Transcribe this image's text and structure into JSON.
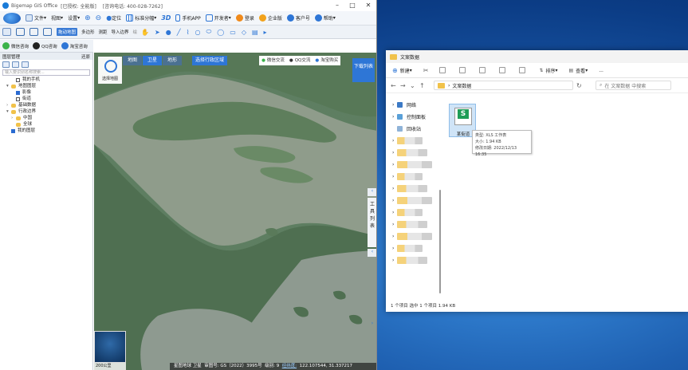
{
  "gis": {
    "title": "Bigemap GIS Office",
    "auth": "[已授权: 全能版]",
    "hotline": "[咨询电话: 400-028-7262]",
    "menu": {
      "file": "文件",
      "view": "视图",
      "settings": "设置",
      "locate": "定位",
      "tiles": "标准分幅",
      "three_d": "3D",
      "mobile": "手机APP",
      "dev": "开发者",
      "login": "登录",
      "enterprise": "企业版",
      "customer": "客户号",
      "help": "帮助"
    },
    "toolbar": {
      "drag": "拖动地图",
      "polygon": "多边形",
      "measure": "测距",
      "import": "导入边界",
      "draw_label": "绘"
    },
    "toolbar2": {
      "wechat": "微信咨询",
      "qq": "QQ咨询",
      "taobao": "淘宝咨询"
    },
    "layers_panel": {
      "title": "图层管理",
      "restore": "还原",
      "search_placeholder": "输入要识别名称搜索...",
      "items": [
        {
          "label": "我的手机",
          "check": false,
          "caret": ""
        },
        {
          "label": "地图图层",
          "check": null,
          "caret": "▾"
        },
        {
          "label": "影像",
          "check": true,
          "caret": ""
        },
        {
          "label": "街道",
          "check": false,
          "caret": ""
        },
        {
          "label": "基础数据",
          "check": null,
          "caret": "›"
        },
        {
          "label": "行政边界",
          "check": null,
          "caret": "▾"
        },
        {
          "label": "中国",
          "check": null,
          "caret": "›"
        },
        {
          "label": "全球",
          "check": null,
          "caret": ""
        },
        {
          "label": "我的图层",
          "check": true,
          "caret": ""
        }
      ]
    },
    "map": {
      "logo_text": "选择地图",
      "tabs": [
        "地图",
        "卫星",
        "地形"
      ],
      "selected_tab": "卫星",
      "region_btn": "选择行政区域",
      "wechat": "微信交流",
      "qq": "QQ交流",
      "taobao": "淘宝购买",
      "download_list": "下载列表",
      "tools_list": [
        "工",
        "具",
        "列",
        "表"
      ],
      "scale": "200公里",
      "status": {
        "source": "星图地球 卫星",
        "approval": "审图号: GS（2022）3995号",
        "level": "级别: 9",
        "coords_label": "经纬度:",
        "coords": "122.107544, 31.337217"
      }
    }
  },
  "explorer": {
    "title": "文案数据",
    "cmd": {
      "new": "新建",
      "sort": "排序",
      "view": "查看",
      "more": "..."
    },
    "addr": {
      "path": "文案数据",
      "search_placeholder": "在 文案数据 中搜索"
    },
    "nav": [
      "网络",
      "控制面板",
      "回收站"
    ],
    "file": {
      "name": "某街道",
      "tip_type": "类型: XLS 工作表",
      "tip_size": "大小: 1.94 KB",
      "tip_date": "修改日期: 2022/12/13 16:35"
    },
    "status": "1 个项目    选中 1 个项目  1.94 KB"
  },
  "colors": {
    "accent": "#2e76d6",
    "excel_green": "#1f9d57",
    "folder": "#f1c24a"
  }
}
